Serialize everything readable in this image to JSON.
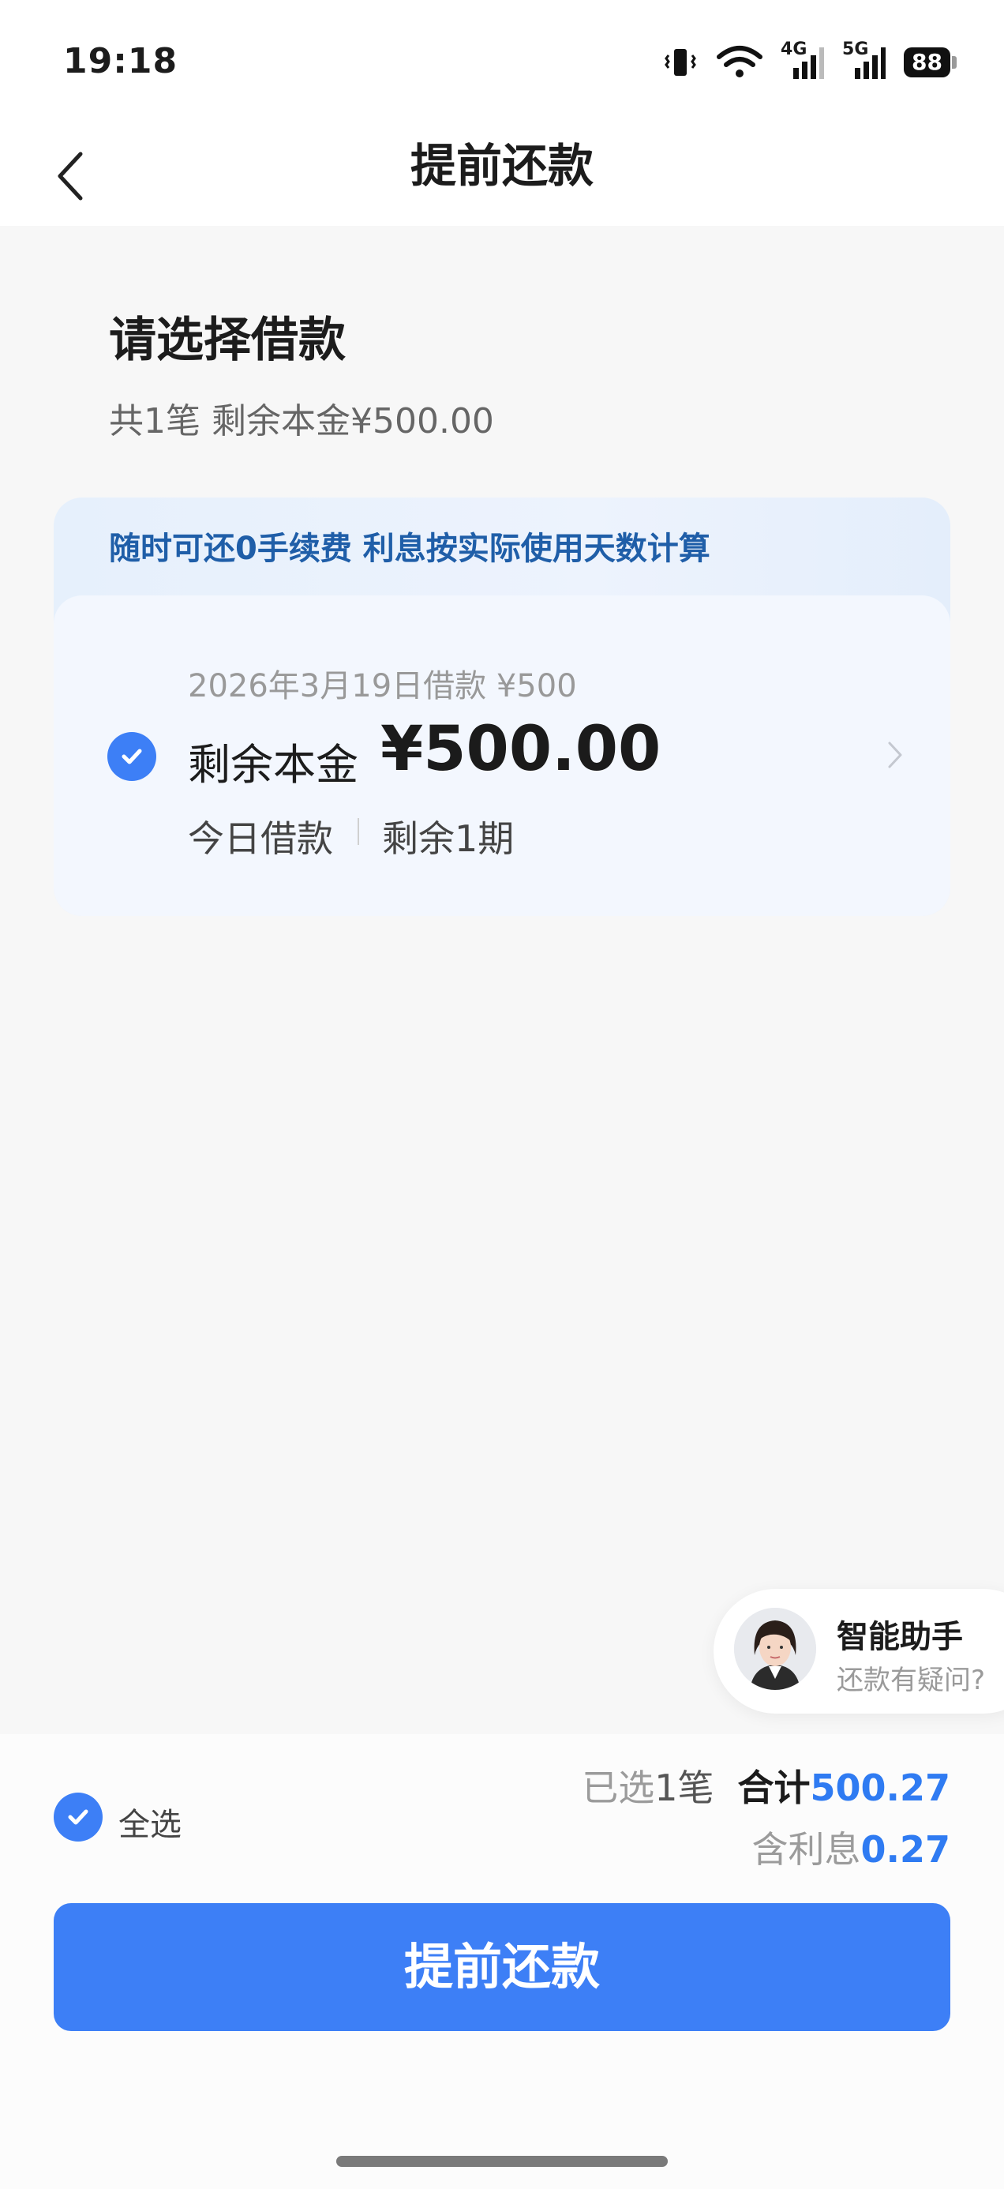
{
  "status_bar": {
    "time": "19:18",
    "network1": "4G",
    "network2": "5G",
    "battery": "88"
  },
  "nav": {
    "title": "提前还款",
    "back_icon": "chevron-left-icon"
  },
  "section": {
    "title": "请选择借款",
    "subtitle": "共1笔 剩余本金¥500.00"
  },
  "card": {
    "banner": "随时可还0手续费 利息按实际使用天数计算",
    "loan_date": "2026年3月19日借款 ¥500",
    "label": "剩余本金",
    "amount": "¥500.00",
    "tag_today": "今日借款",
    "tag_remaining": "剩余1期",
    "selected": true
  },
  "assistant": {
    "title": "智能助手",
    "subtitle": "还款有疑问?"
  },
  "bottom": {
    "select_all": "全选",
    "selected_prefix": "已选",
    "selected_count": "1笔",
    "total_label": "合计",
    "total_value": "500.27",
    "interest_label": "含利息",
    "interest_value": "0.27",
    "button": "提前还款"
  },
  "colors": {
    "accent": "#3d7ff6",
    "amount_blue": "#2f7bf2",
    "banner_text": "#1f5ea8"
  }
}
